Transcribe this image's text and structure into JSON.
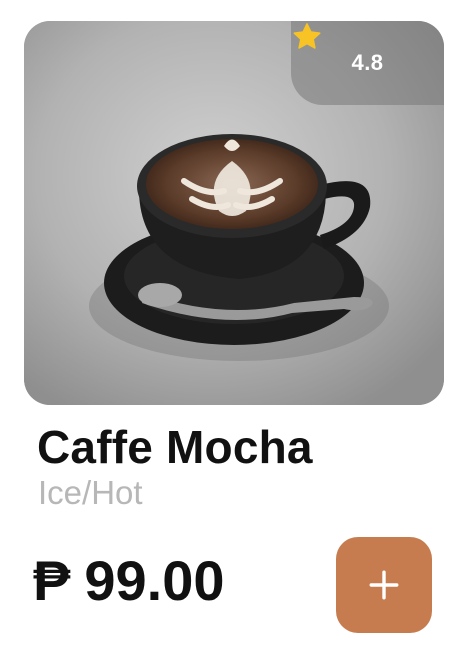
{
  "product": {
    "name": "Caffe Mocha",
    "variant": "Ice/Hot",
    "currency_symbol": "₱",
    "price": "99.00",
    "rating": "4.8",
    "image_description_icon": "coffee-cup-photo"
  },
  "actions": {
    "add_icon": "plus-icon"
  },
  "colors": {
    "accent": "#c67c4e",
    "star": "#f7c325",
    "title": "#111111",
    "subtitle": "#b7b7b7"
  }
}
